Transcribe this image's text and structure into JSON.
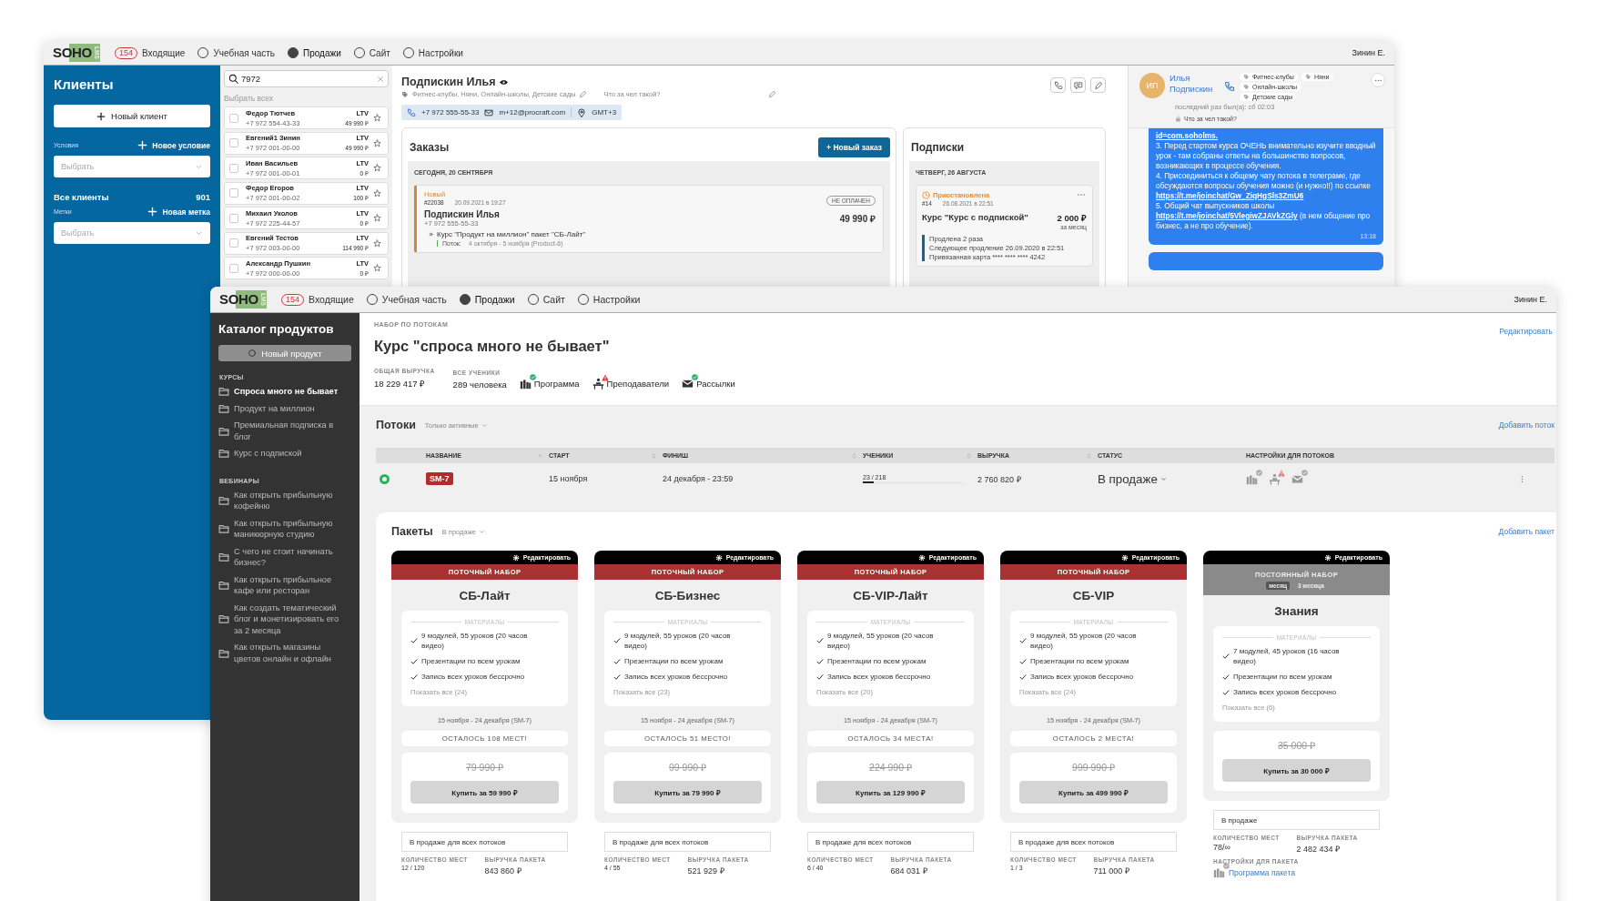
{
  "back_window": {
    "top_bar": {
      "logo": {
        "text": "SOHO",
        "sub": "LMS"
      },
      "nav": [
        {
          "kind": "badge",
          "badge": "154",
          "label": "Входящие",
          "selected": false
        },
        {
          "kind": "radio",
          "label": "Учебная часть",
          "selected": false
        },
        {
          "kind": "radio",
          "label": "Продажи",
          "selected": true
        },
        {
          "kind": "radio",
          "label": "Сайт",
          "selected": false
        },
        {
          "kind": "radio",
          "label": "Настройки",
          "selected": false
        }
      ],
      "user": "Зинин Е."
    },
    "sidebar": {
      "title": "Клиенты",
      "new_button": "Новый клиент",
      "conditions": {
        "label": "Условия",
        "add": "Новое условие",
        "placeholder": "Выбрать"
      },
      "all_clients": {
        "label": "Все клиенты",
        "count": "901"
      },
      "tags": {
        "label": "Метки",
        "add": "Новая метка",
        "placeholder": "Выбрать"
      }
    },
    "client_list": {
      "search": "7972",
      "select_all": "Выбрать всех",
      "clients": [
        {
          "name": "Федор Тютчев",
          "phone": "+7 972 554-43-33",
          "ltv_label": "LTV",
          "ltv": "49 990 ₽",
          "checked": false,
          "starred": false
        },
        {
          "name": "Евгений1 Зинин",
          "phone": "+7 972 001-00-00",
          "ltv_label": "LTV",
          "ltv": "49 990 ₽",
          "checked": false,
          "starred": false
        },
        {
          "name": "Иван Васильев",
          "phone": "+7 972 001-00-01",
          "ltv_label": "LTV",
          "ltv": "0 ₽",
          "checked": false,
          "starred": false
        },
        {
          "name": "Федор Егоров",
          "phone": "+7 972 001-00-02",
          "ltv_label": "LTV",
          "ltv": "100 ₽",
          "checked": false,
          "starred": false
        },
        {
          "name": "Михаил Уколов",
          "phone": "+7 972 225-44-57",
          "ltv_label": "LTV",
          "ltv": "0 ₽",
          "checked": false,
          "starred": false
        },
        {
          "name": "Евгений Тестов",
          "phone": "+7 972 003-00-00",
          "ltv_label": "LTV",
          "ltv": "114 990 ₽",
          "checked": false,
          "starred": false
        },
        {
          "name": "Александр Пушкин",
          "phone": "+7 972 000-00-00",
          "ltv_label": "LTV",
          "ltv": "0 ₽",
          "checked": false,
          "starred": false
        }
      ]
    },
    "client": {
      "name": "Подпискин Илья",
      "tags": "Фитнес-клубы, Няни, Онлайн-школы, Детские сады",
      "note": "Что за чел такой?",
      "phone": "+7 972 555-55-33",
      "email": "m+12@procraft.com",
      "timezone": "GMT+3"
    },
    "orders": {
      "title": "Заказы",
      "new_button": "+ Новый заказ",
      "date": "СЕГОДНЯ, 20 СЕНТЯБРЯ",
      "order": {
        "status": "Новый",
        "number": "#22038",
        "datetime": "20.09.2021 в 19:27",
        "payment": "НЕ ОПЛАЧЕН",
        "customer": "Подпискин Илья",
        "phone": "+7 972 555-55-33",
        "amount": "49 990 ₽",
        "item": "Курс \"Продукт на миллион\" пакет \"СБ-Лайт\"",
        "stream_label": "Поток:",
        "stream": "4 октября - 5 ноября (Product-6)"
      }
    },
    "subscriptions": {
      "title": "Подписки",
      "date": "ЧЕТВЕРГ, 26 АВГУСТА",
      "subscription": {
        "status": "Приостановлена",
        "number": "#14",
        "datetime": "26.08.2021 в 22:51",
        "name": "Курс \"Курс с подпиской\"",
        "price": "2 000 ₽",
        "period": "за месяц",
        "details": [
          "Продлена 2 раза",
          "Следующее продление 26.09.2020 в 22:51",
          "Привязанная карта **** **** **** 4242"
        ]
      }
    },
    "chat": {
      "avatar": "ИП",
      "name": "Илья Подпискин",
      "tags": [
        "Фитнес-клубы",
        "Няни",
        "Онлайн-школы",
        "Детские сады"
      ],
      "last_seen": "последний раз был(а): сб 02:03",
      "note": "Что за чел такой?",
      "message": {
        "paragraphs": [
          [
            {
              "kind": "link",
              "text": "id=com.soholms."
            }
          ],
          [
            {
              "kind": "text",
              "text": "3. Перед стартом курса ОЧЕНЬ внимательно изучите вводный урок - там собраны ответы на большинство вопросов, возникающих в процессе обучения."
            }
          ],
          [
            {
              "kind": "text",
              "text": "4. Присоединиться к общему чату потока в телеграме, где обсуждаются вопросы обучения можно (и нужно!!) по ссылке"
            }
          ],
          [
            {
              "kind": "link",
              "text": "https://t.me/joinchat/Gw_ZiqHgSls3ZmU6"
            }
          ],
          [
            {
              "kind": "text",
              "text": "5. Общий чат выпускников школы"
            }
          ],
          [
            {
              "kind": "link",
              "text": "https://t.me/joinchat/5VlegiwZJAVkZGly"
            },
            {
              "kind": "text",
              "text": " (в нем общение про бизнес, а не про обучение)."
            }
          ]
        ],
        "time": "13:18"
      }
    }
  },
  "front_window": {
    "top_bar": {
      "logo": {
        "text": "SOHO",
        "sub": "LMS"
      },
      "nav": [
        {
          "kind": "badge",
          "badge": "154",
          "label": "Входящие",
          "selected": false
        },
        {
          "kind": "radio",
          "label": "Учебная часть",
          "selected": false
        },
        {
          "kind": "radio",
          "label": "Продажи",
          "selected": true
        },
        {
          "kind": "radio",
          "label": "Сайт",
          "selected": false
        },
        {
          "kind": "radio",
          "label": "Настройки",
          "selected": false
        }
      ],
      "user": "Зинин Е."
    },
    "sidebar": {
      "title": "Каталог продуктов",
      "new_button": "Новый продукт",
      "sections": [
        {
          "title": "КУРСЫ",
          "items": [
            {
              "label": "Спроса много не бывает",
              "selected": true
            },
            {
              "label": "Продукт на миллион",
              "selected": false
            },
            {
              "label": "Премиальная подписка в блог",
              "selected": false
            },
            {
              "label": "Курс с подпиской",
              "selected": false
            }
          ]
        },
        {
          "title": "ВЕБИНАРЫ",
          "items": [
            {
              "label": "Как открыть прибыльную кофейню",
              "selected": false
            },
            {
              "label": "Как открыть прибыльную маникюрную студию",
              "selected": false
            },
            {
              "label": "С чего не стоит начинать бизнес?",
              "selected": false
            },
            {
              "label": "Как открыть прибыльное кафе или ресторан",
              "selected": false
            },
            {
              "label": "Как создать тематический блог и монетизировать его за 2 месяца",
              "selected": false
            },
            {
              "label": "Как открыть магазины цветов онлайн и офлайн",
              "selected": false
            }
          ]
        }
      ]
    },
    "product": {
      "overline": "НАБОР ПО ПОТОКАМ",
      "title": "Курс \"спроса много не бывает\"",
      "edit": "Редактировать",
      "stats": [
        {
          "label": "ОБЩАЯ ВЫРУЧКА",
          "value": "18 229 417 ₽"
        },
        {
          "label": "ВСЕ УЧЕНИКИ",
          "value": "289 человека"
        }
      ],
      "features": [
        {
          "kind": "program",
          "label": "Программа",
          "warning": false
        },
        {
          "kind": "teachers",
          "label": "Преподаватели",
          "warning": true
        },
        {
          "kind": "mailing",
          "label": "Рассылки",
          "warning": false
        }
      ]
    },
    "streams": {
      "title": "Потоки",
      "filter": "Только активные",
      "add": "Добавить поток",
      "columns": [
        {
          "label": "НАЗВАНИЕ",
          "sortable": true,
          "sorted": true
        },
        {
          "label": "СТАРТ",
          "sortable": true,
          "sorted": false
        },
        {
          "label": "ФИНИШ",
          "sortable": true,
          "sorted": false
        },
        {
          "label": "УЧЕНИКИ",
          "sortable": true,
          "sorted": false
        },
        {
          "label": "ВЫРУЧКА",
          "sortable": true,
          "sorted": false
        },
        {
          "label": "СТАТУС",
          "sortable": false,
          "sorted": false
        },
        {
          "label": "НАСТРОЙКИ ДЛЯ ПОТОКОВ",
          "sortable": false,
          "sorted": false
        }
      ],
      "rows": [
        {
          "active": true,
          "code": "SM-7",
          "start": "15 ноября",
          "finish": "24 декабря - 23:59",
          "students": "23 / 218",
          "level": 0.105,
          "revenue": "2 760 820 ₽",
          "status": "В продаже",
          "settings": [
            {
              "kind": "program",
              "warning": false
            },
            {
              "kind": "teachers",
              "warning": true
            },
            {
              "kind": "mailing",
              "warning": false
            }
          ]
        }
      ]
    },
    "packages": {
      "title": "Пакеты",
      "filter": "В продаже",
      "add": "Добавить пакет",
      "items": [
        {
          "kind": "stream",
          "edit": "Редактировать",
          "band": "ПОТОЧНЫЙ НАБОР",
          "name": "СБ-Лайт",
          "materials_label": "МАТЕРИАЛЫ",
          "materials": [
            "9 модулей, 55 уроков (20 часов видео)",
            "Презентации по всем урокам",
            "Запись всех уроков бессрочно"
          ],
          "show_all": "Показать все (24)",
          "dates": "15 ноября - 24 декабря (SM-7)",
          "seats_left": "ОСТАЛОСЬ 108 МЕСТ!",
          "old_price": "79 990 ₽",
          "buy": "Купить за 59 990 ₽",
          "sale_status": "В продаже для всех потоков",
          "seats_label": "КОЛИЧЕСТВО МЕСТ",
          "seats": "12 / 120",
          "revenue_label": "ВЫРУЧКА ПАКЕТА",
          "revenue": "843 860 ₽"
        },
        {
          "kind": "stream",
          "edit": "Редактировать",
          "band": "ПОТОЧНЫЙ НАБОР",
          "name": "СБ-Бизнес",
          "materials_label": "МАТЕРИАЛЫ",
          "materials": [
            "9 модулей, 55 уроков (20 часов видео)",
            "Презентации по всем урокам",
            "Запись всех уроков бессрочно"
          ],
          "show_all": "Показать все (23)",
          "dates": "15 ноября - 24 декабря (SM-7)",
          "seats_left": "ОСТАЛОСЬ 51 МЕСТО!",
          "old_price": "99 990 ₽",
          "buy": "Купить за 79 990 ₽",
          "sale_status": "В продаже для всех потоков",
          "seats_label": "КОЛИЧЕСТВО МЕСТ",
          "seats": "4 / 55",
          "revenue_label": "ВЫРУЧКА ПАКЕТА",
          "revenue": "521 929 ₽"
        },
        {
          "kind": "stream",
          "edit": "Редактировать",
          "band": "ПОТОЧНЫЙ НАБОР",
          "name": "СБ-VIP-Лайт",
          "materials_label": "МАТЕРИАЛЫ",
          "materials": [
            "9 модулей, 55 уроков (20 часов видео)",
            "Презентации по всем урокам",
            "Запись всех уроков бессрочно"
          ],
          "show_all": "Показать все (20)",
          "dates": "15 ноября - 24 декабря (SM-7)",
          "seats_left": "ОСТАЛОСЬ 34 МЕСТА!",
          "old_price": "224 990 ₽",
          "buy": "Купить за 129 990 ₽",
          "sale_status": "В продаже для всех потоков",
          "seats_label": "КОЛИЧЕСТВО МЕСТ",
          "seats": "6 / 40",
          "revenue_label": "ВЫРУЧКА ПАКЕТА",
          "revenue": "684 031 ₽"
        },
        {
          "kind": "stream",
          "edit": "Редактировать",
          "band": "ПОТОЧНЫЙ НАБОР",
          "name": "СБ-VIP",
          "materials_label": "МАТЕРИАЛЫ",
          "materials": [
            "9 модулей, 55 уроков (20 часов видео)",
            "Презентации по всем урокам",
            "Запись всех уроков бессрочно"
          ],
          "show_all": "Показать все (24)",
          "dates": "15 ноября - 24 декабря (SM-7)",
          "seats_left": "ОСТАЛОСЬ 2 МЕСТА!",
          "old_price": "999 990 ₽",
          "buy": "Купить за 499 990 ₽",
          "sale_status": "В продаже для всех потоков",
          "seats_label": "КОЛИЧЕСТВО МЕСТ",
          "seats": "1 / 3",
          "revenue_label": "ВЫРУЧКА ПАКЕТА",
          "revenue": "711 000 ₽"
        },
        {
          "kind": "permanent",
          "edit": "Редактировать",
          "band": "ПОСТОЯННЫЙ НАБОР",
          "periods": [
            {
              "label": "месяц",
              "selected": true
            },
            {
              "label": "3 месяца",
              "selected": false
            }
          ],
          "name": "Знания",
          "materials_label": "МАТЕРИАЛЫ",
          "materials": [
            "7 модулей, 45 уроков (16 часов видео)",
            "Презентации по всем урокам",
            "Запись всех уроков бессрочно"
          ],
          "show_all": "Показать все (6)",
          "old_price": "35 000 ₽",
          "buy": "Купить за 30 000 ₽",
          "sale_status": "В продаже",
          "seats_label": "КОЛИЧЕСТВО МЕСТ",
          "seats": "78/∞",
          "revenue_label": "ВЫРУЧКА ПАКЕТА",
          "revenue": "2 482 434 ₽",
          "settings_label": "НАСТРОЙКИ ДЛЯ ПАКЕТА",
          "settings_link": "Программа пакета"
        }
      ]
    }
  }
}
